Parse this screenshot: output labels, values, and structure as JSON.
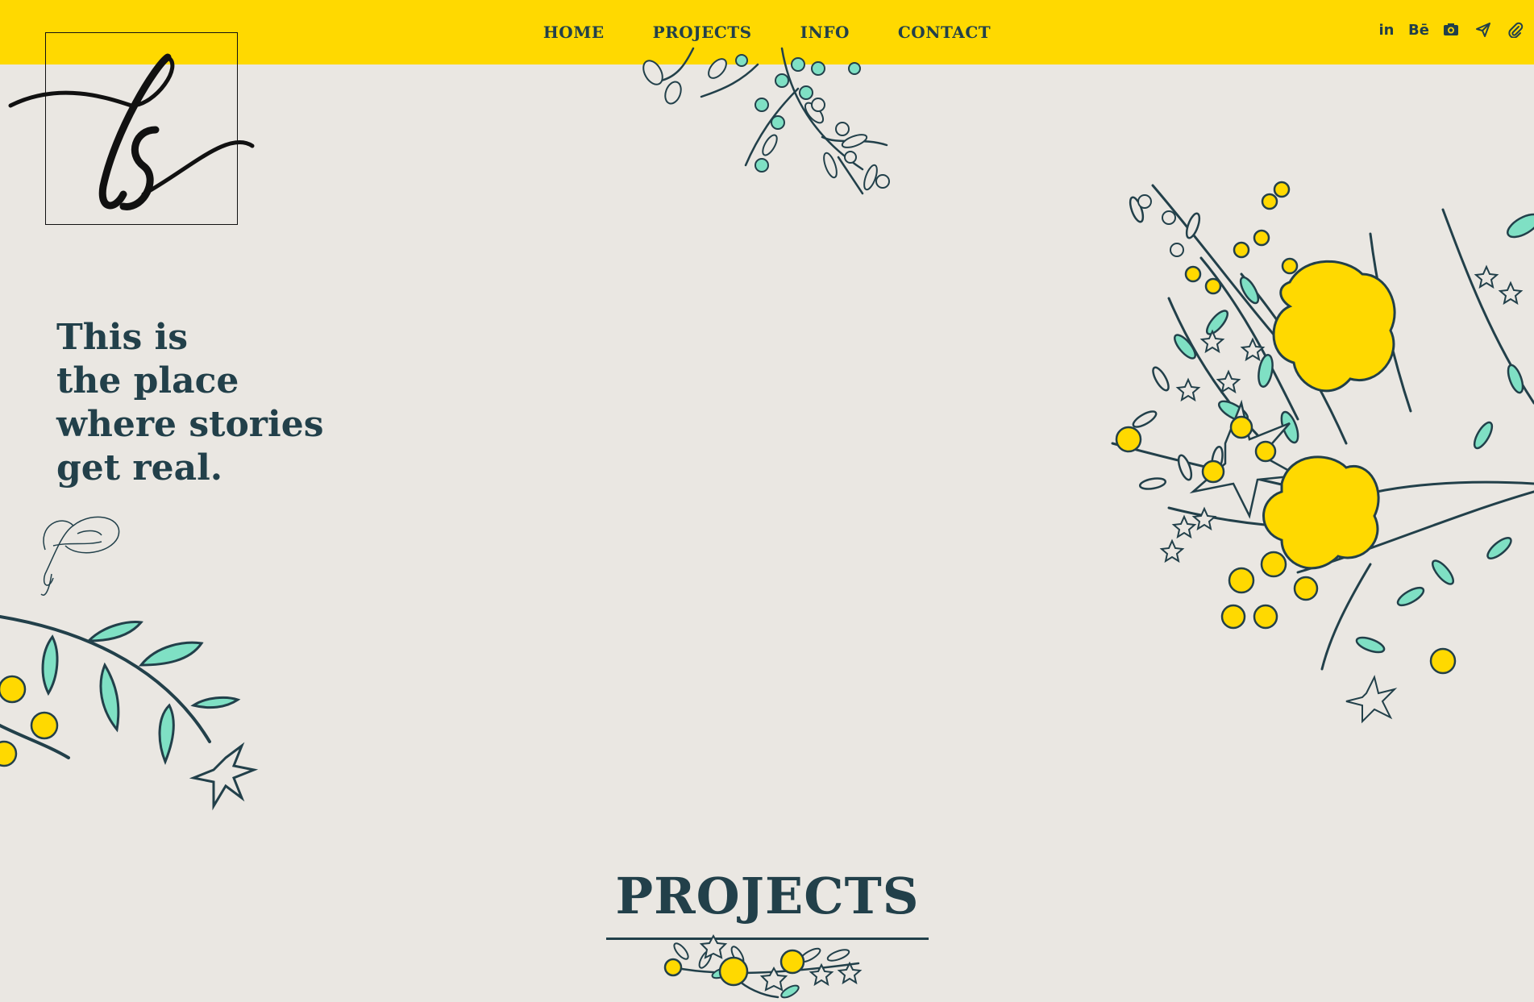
{
  "nav": {
    "items": [
      "HOME",
      "PROJECTS",
      "INFO",
      "CONTACT"
    ]
  },
  "social": {
    "icons": [
      "linkedin-icon",
      "behance-icon",
      "camera-icon",
      "send-icon",
      "attachment-icon"
    ],
    "behance_text": "Bē",
    "linkedin_text": "in"
  },
  "logo": {
    "text": "ls"
  },
  "hero": {
    "line1": "This is",
    "line2": "the place",
    "line3": "where stories",
    "line4": "get real."
  },
  "projects": {
    "title": "PROJECTS"
  },
  "colors": {
    "topbar": "#ffd900",
    "background": "#eae7e2",
    "ink": "#22404a",
    "mint": "#7fe0c4",
    "flower": "#ffd900"
  }
}
